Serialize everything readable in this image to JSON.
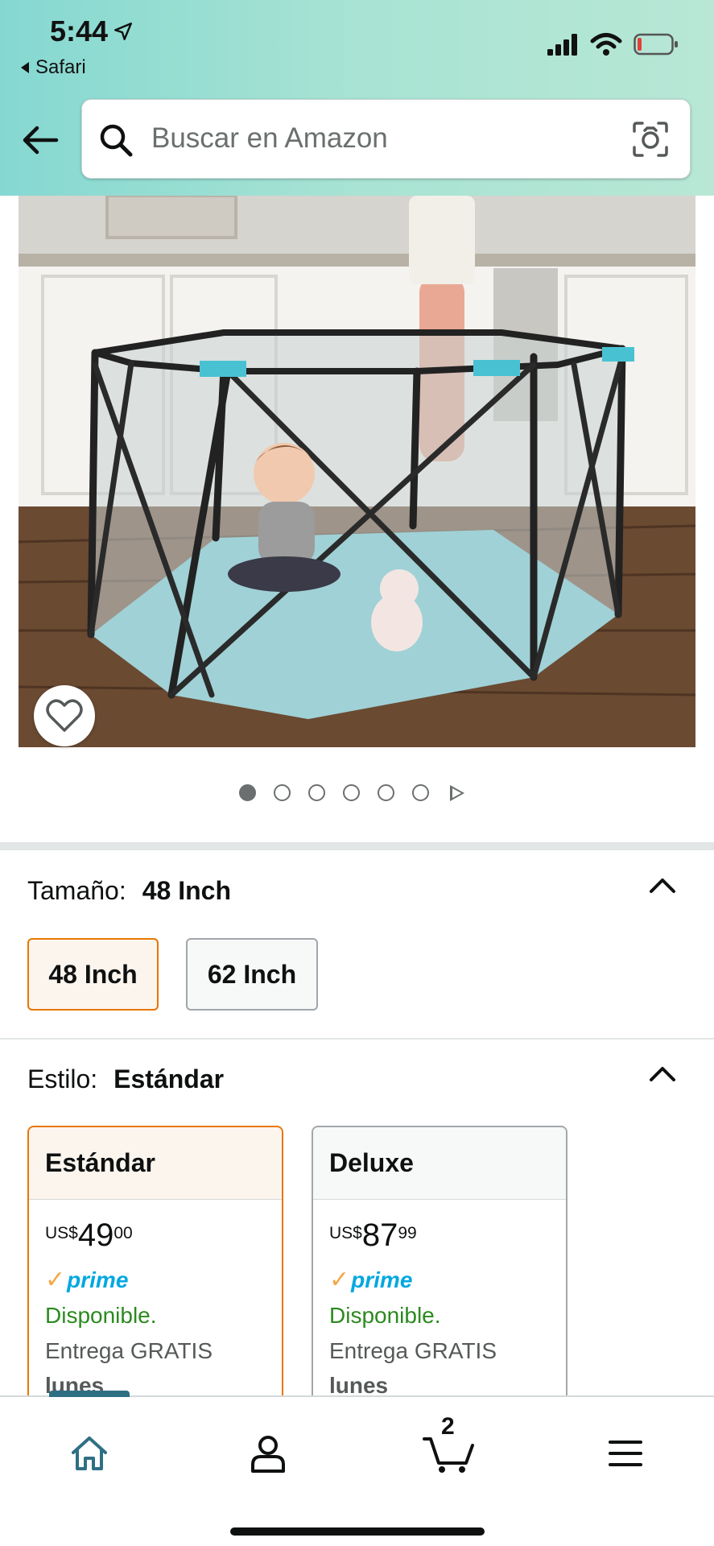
{
  "status_bar": {
    "time": "5:44",
    "back_app": "Safari"
  },
  "search": {
    "placeholder": "Buscar en Amazon"
  },
  "carousel": {
    "total_images": 6,
    "active_index": 0
  },
  "size_selector": {
    "label": "Tamaño:",
    "selected_value": "48 Inch",
    "options": [
      "48 Inch",
      "62 Inch"
    ]
  },
  "style_selector": {
    "label": "Estilo:",
    "selected_value": "Estándar",
    "options": [
      {
        "title": "Estándar",
        "currency": "US$",
        "price_whole": "49",
        "price_fraction": "00",
        "prime": "prime",
        "availability": "Disponible.",
        "delivery": "Entrega GRATIS",
        "day": "lunes"
      },
      {
        "title": "Deluxe",
        "currency": "US$",
        "price_whole": "87",
        "price_fraction": "99",
        "prime": "prime",
        "availability": "Disponible.",
        "delivery": "Entrega GRATIS",
        "day": "lunes"
      }
    ]
  },
  "bottom_nav": {
    "cart_count": "2"
  },
  "colors": {
    "header_gradient_start": "#85d8d2",
    "header_gradient_end": "#b8e7d5",
    "selected_border": "#e77600",
    "prime_blue": "#00a8e1",
    "available_green": "#2b8a1f",
    "nav_active": "#2f6f84"
  }
}
